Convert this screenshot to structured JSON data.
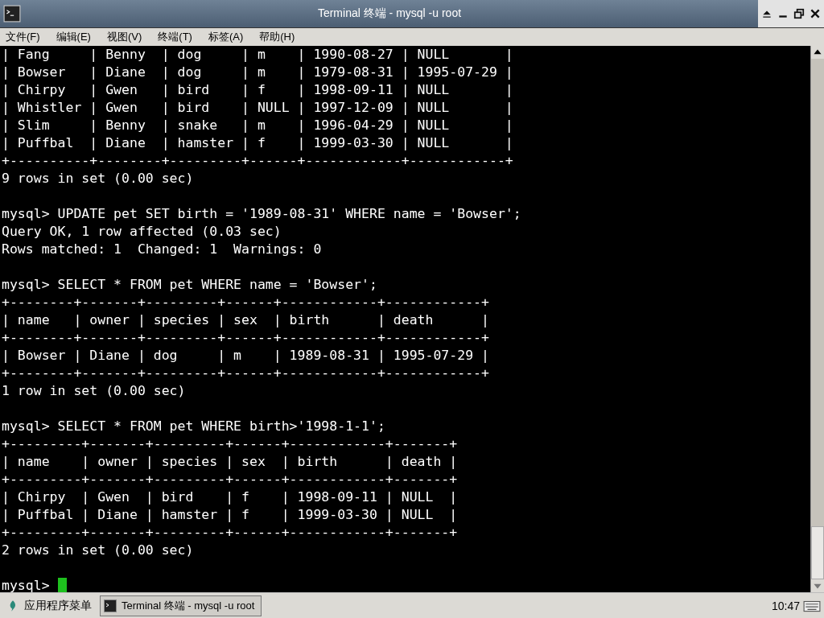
{
  "window": {
    "title": "Terminal 终端 - mysql -u root"
  },
  "menu": [
    "文件(F)",
    "编辑(E)",
    "视图(V)",
    "终端(T)",
    "标签(A)",
    "帮助(H)"
  ],
  "terminal": {
    "blocks": [
      [
        "| Fang     | Benny  | dog     | m    | 1990-08-27 | NULL       |",
        "| Bowser   | Diane  | dog     | m    | 1979-08-31 | 1995-07-29 |",
        "| Chirpy   | Gwen   | bird    | f    | 1998-09-11 | NULL       |",
        "| Whistler | Gwen   | bird    | NULL | 1997-12-09 | NULL       |",
        "| Slim     | Benny  | snake   | m    | 1996-04-29 | NULL       |",
        "| Puffbal  | Diane  | hamster | f    | 1999-03-30 | NULL       |",
        "+----------+--------+---------+------+------------+------------+",
        "9 rows in set (0.00 sec)"
      ],
      [
        "mysql> UPDATE pet SET birth = '1989-08-31' WHERE name = 'Bowser';",
        "Query OK, 1 row affected (0.03 sec)",
        "Rows matched: 1  Changed: 1  Warnings: 0"
      ],
      [
        "mysql> SELECT * FROM pet WHERE name = 'Bowser';",
        "+--------+-------+---------+------+------------+------------+",
        "| name   | owner | species | sex  | birth      | death      |",
        "+--------+-------+---------+------+------------+------------+",
        "| Bowser | Diane | dog     | m    | 1989-08-31 | 1995-07-29 |",
        "+--------+-------+---------+------+------------+------------+",
        "1 row in set (0.00 sec)"
      ],
      [
        "mysql> SELECT * FROM pet WHERE birth>'1998-1-1';",
        "+---------+-------+---------+------+------------+-------+",
        "| name    | owner | species | sex  | birth      | death |",
        "+---------+-------+---------+------+------------+-------+",
        "| Chirpy  | Gwen  | bird    | f    | 1998-09-11 | NULL  |",
        "| Puffbal | Diane | hamster | f    | 1999-03-30 | NULL  |",
        "+---------+-------+---------+------+------------+-------+",
        "2 rows in set (0.00 sec)"
      ]
    ],
    "prompt": "mysql>"
  },
  "taskbar": {
    "start_menu": "应用程序菜单",
    "tasks": [
      {
        "label": "Terminal 终端 - mysql -u root",
        "selected": true
      }
    ],
    "clock": "10:47"
  }
}
